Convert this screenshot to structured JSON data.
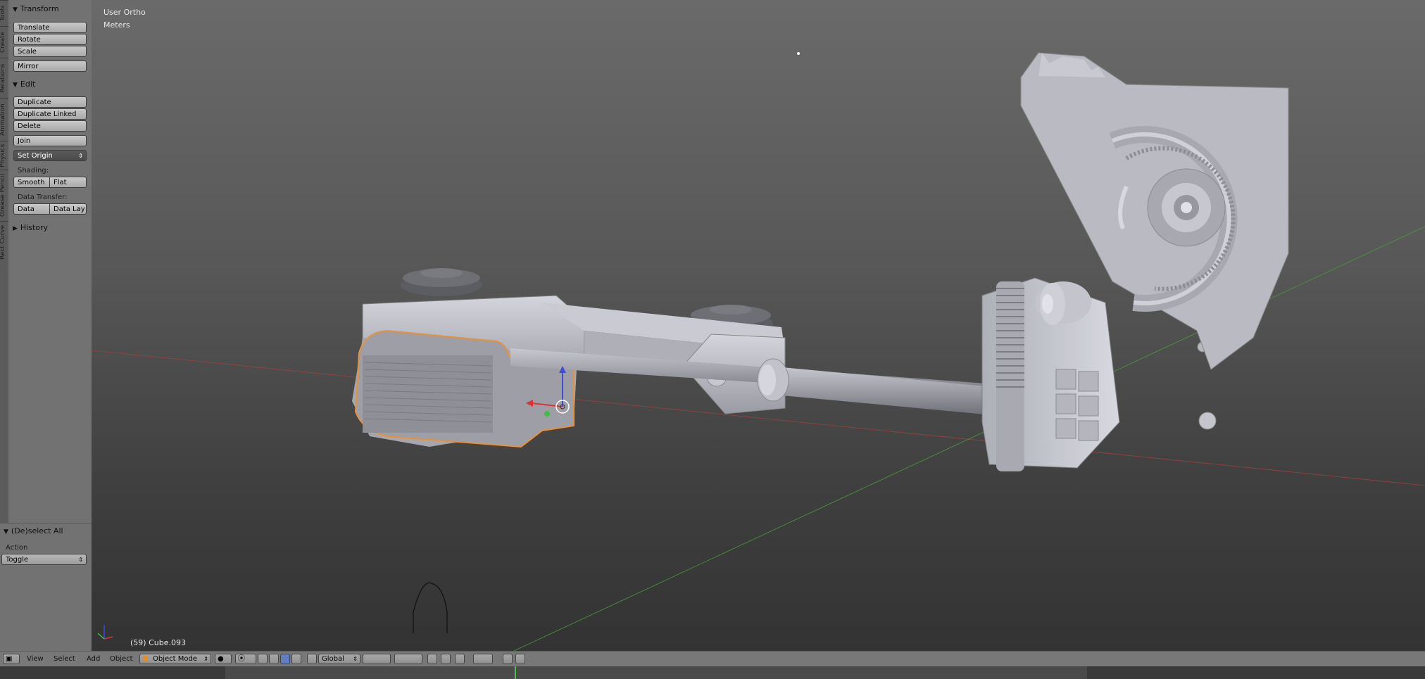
{
  "tabs": [
    "Tools",
    "Create",
    "Relations",
    "Animation",
    "Physics",
    "Grease Pencil",
    "Rect Curve"
  ],
  "transform": {
    "header": "Transform",
    "buttons": [
      "Translate",
      "Rotate",
      "Scale",
      "Mirror"
    ]
  },
  "edit": {
    "header": "Edit",
    "duplicate": "Duplicate",
    "duplicate_linked": "Duplicate Linked",
    "delete": "Delete",
    "join": "Join",
    "set_origin": "Set Origin",
    "shading_label": "Shading:",
    "smooth": "Smooth",
    "flat": "Flat",
    "data_transfer_label": "Data Transfer:",
    "data": "Data",
    "data_lay": "Data Lay"
  },
  "history": {
    "header": "History"
  },
  "operator": {
    "header": "(De)select All",
    "action_label": "Action",
    "action_value": "Toggle"
  },
  "viewport": {
    "view_name": "User Ortho",
    "units": "Meters",
    "object_info": "(59) Cube.093"
  },
  "footer": {
    "view": "View",
    "select": "Select",
    "add": "Add",
    "object": "Object",
    "mode": "Object Mode",
    "orientation": "Global"
  },
  "colors": {
    "selection_outline": "#e8903a",
    "x_axis": "#b23b3b",
    "y_axis": "#5aa84a",
    "panel_bg": "#727272"
  }
}
